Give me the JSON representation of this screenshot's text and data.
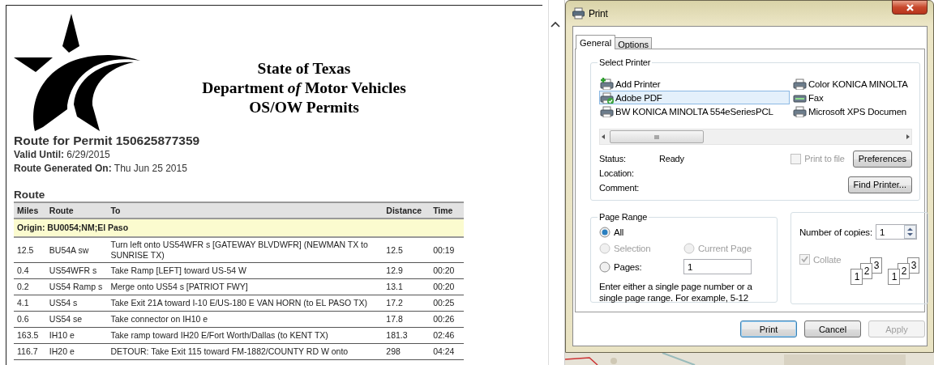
{
  "document": {
    "heading_lines": [
      "State of Texas",
      "Department *of* Motor Vehicles",
      "OS/OW Permits"
    ],
    "title": "Route for Permit 150625877359",
    "meta": [
      {
        "label": "Valid Until:",
        "value": "6/29/2015"
      },
      {
        "label": "Route Generated On:",
        "value": "Thu Jun 25 2015"
      }
    ],
    "section": "Route",
    "table": {
      "columns": [
        "Miles",
        "Route",
        "To",
        "Distance",
        "Time"
      ],
      "origin": "Origin: BU0054;NM;El Paso",
      "rows": [
        [
          "12.5",
          "BU54A sw",
          "Turn left onto US54WFR s [GATEWAY BLVDWFR] (NEWMAN TX to SUNRISE TX)",
          "12.5",
          "00:19"
        ],
        [
          "0.4",
          "US54WFR s",
          "Take Ramp [LEFT] toward US-54 W",
          "12.9",
          "00:20"
        ],
        [
          "0.2",
          "US54 Ramp s",
          "Merge onto US54 s [PATRIOT FWY]",
          "13.1",
          "00:20"
        ],
        [
          "4.1",
          "US54 s",
          "Take Exit 21A toward I-10 E/US-180 E VAN HORN (to EL PASO TX)",
          "17.2",
          "00:25"
        ],
        [
          "0.6",
          "US54 se",
          "Take connector on IH10 e",
          "17.8",
          "00:26"
        ],
        [
          "163.5",
          "IH10 e",
          "Take ramp toward IH20 E/Fort Worth/Dallas (to KENT TX)",
          "181.3",
          "02:46"
        ],
        [
          "116.7",
          "IH20 e",
          "DETOUR: Take Exit 115 toward FM-1882/COUNTY RD W onto",
          "298",
          "04:24"
        ]
      ]
    }
  },
  "dialog": {
    "title": "Print",
    "tabs": [
      {
        "label": "General",
        "selected": true
      },
      {
        "label": "Options",
        "selected": false
      }
    ],
    "select_printer": {
      "label": "Select Printer",
      "printers": [
        {
          "name": "Add Printer",
          "kind": "add",
          "selected": false
        },
        {
          "name": "Adobe PDF",
          "kind": "default",
          "selected": true
        },
        {
          "name": "BW KONICA MINOLTA 554eSeriesPCL",
          "kind": "printer",
          "selected": false
        },
        {
          "name": "Color KONICA MINOLTA",
          "kind": "printer",
          "selected": false
        },
        {
          "name": "Fax",
          "kind": "fax",
          "selected": false
        },
        {
          "name": "Microsoft XPS Documen",
          "kind": "printer",
          "selected": false
        }
      ],
      "status_label": "Status:",
      "status": "Ready",
      "location_label": "Location:",
      "comment_label": "Comment:",
      "print_to_file": {
        "label": "Print to file",
        "checked": false,
        "disabled": true
      },
      "buttons": [
        "Preferences",
        "Find Printer..."
      ]
    },
    "page_range": {
      "label": "Page Range",
      "options": [
        {
          "label": "All",
          "selected": true,
          "disabled": false
        },
        {
          "label": "Selection",
          "selected": false,
          "disabled": true
        },
        {
          "label": "Current Page",
          "selected": false,
          "disabled": true
        },
        {
          "label": "Pages:",
          "selected": false,
          "disabled": false
        }
      ],
      "pages_value": "1",
      "hint": "Enter either a single page number or a single page range.  For example, 5-12"
    },
    "copies": {
      "label": "Number of copies:",
      "value": "1",
      "collate": {
        "label": "Collate",
        "checked": true,
        "disabled": true
      },
      "collate_stacks": [
        [
          "1",
          "2",
          "3"
        ],
        [
          "1",
          "2",
          "3"
        ]
      ]
    },
    "buttons": [
      {
        "label": "Print",
        "default": true,
        "disabled": false
      },
      {
        "label": "Cancel",
        "default": false,
        "disabled": false
      },
      {
        "label": "Apply",
        "default": false,
        "disabled": true
      }
    ]
  }
}
